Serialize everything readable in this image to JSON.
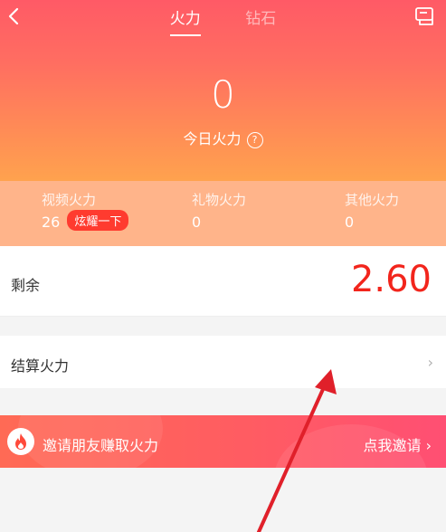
{
  "header": {
    "tabs": [
      {
        "label": "火力",
        "active": true
      },
      {
        "label": "钻石",
        "active": false
      }
    ]
  },
  "summary": {
    "today_value": "0",
    "today_label": "今日火力",
    "help_symbol": "?"
  },
  "stats": [
    {
      "label": "视频火力",
      "value": "26",
      "action": "炫耀一下"
    },
    {
      "label": "礼物火力",
      "value": "0"
    },
    {
      "label": "其他火力",
      "value": "0"
    }
  ],
  "balance": {
    "label": "剩余",
    "amount": "2.60"
  },
  "settle": {
    "label": "结算火力",
    "chevron": "›"
  },
  "invite": {
    "text": "邀请朋友赚取火力",
    "action": "点我邀请 ›"
  },
  "colors": {
    "hero_top": "#ff5a66",
    "hero_bottom": "#ffa24e",
    "stats_bg": "#ffb48a",
    "amount": "#f2251c",
    "annotation_arrow": "#e0202a"
  },
  "icons": [
    "back-arrow-icon",
    "wallet-icon",
    "help-icon",
    "fire-icon",
    "chevron-right-icon"
  ]
}
